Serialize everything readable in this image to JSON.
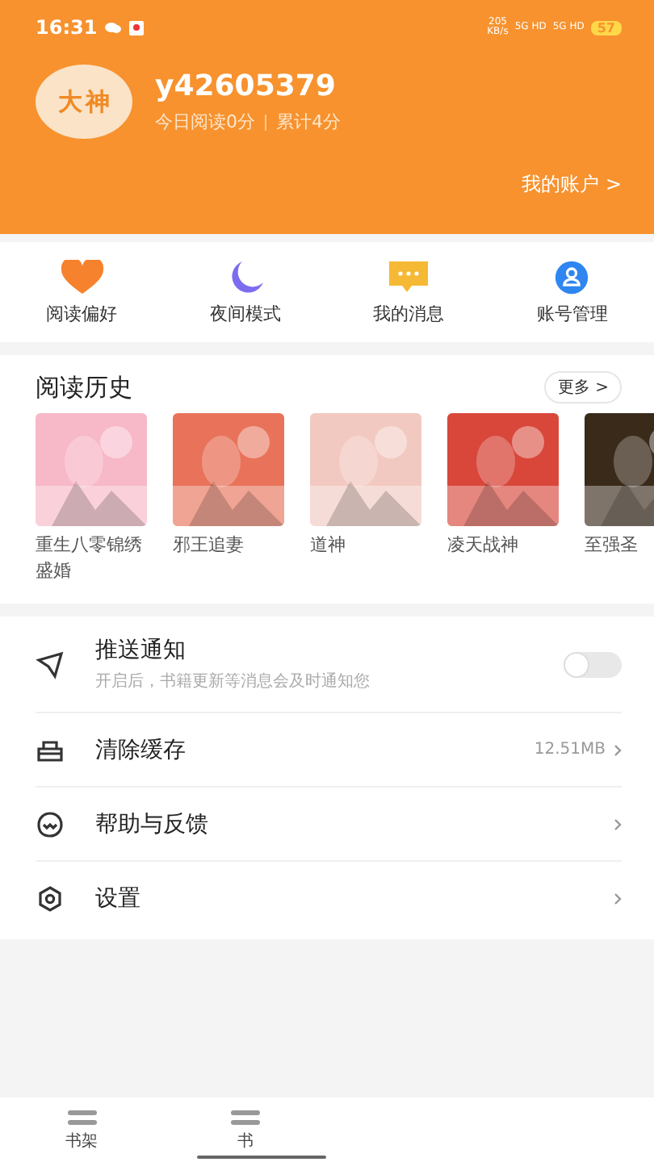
{
  "status_bar": {
    "time": "16:31",
    "network_speed": "205",
    "network_unit": "KB/s",
    "signal_1": "5G HD",
    "signal_2": "5G HD",
    "battery": "57"
  },
  "profile": {
    "avatar_text_1": "大",
    "avatar_text_2": "神",
    "username": "y42605379",
    "today_reading": "今日阅读0分",
    "total": "累计4分",
    "account_link": "我的账户 >"
  },
  "shortcuts": [
    {
      "label": "阅读偏好",
      "kind": "heart"
    },
    {
      "label": "夜间模式",
      "kind": "moon"
    },
    {
      "label": "我的消息",
      "kind": "message"
    },
    {
      "label": "账号管理",
      "kind": "user"
    }
  ],
  "history": {
    "title": "阅读历史",
    "more": "更多 >",
    "books": [
      {
        "title": "重生八零锦绣盛婚"
      },
      {
        "title": "邪王追妻"
      },
      {
        "title": "道神"
      },
      {
        "title": "凌天战神"
      },
      {
        "title": "至强圣"
      }
    ]
  },
  "settings": [
    {
      "label": "推送通知",
      "kind": "toggle",
      "hint": "开启后，书籍更新等消息会及时通知您",
      "on": false
    },
    {
      "label": "清除缓存",
      "kind": "link",
      "value": "12.51MB"
    },
    {
      "label": "帮助与反馈",
      "kind": "link"
    },
    {
      "label": "设置",
      "kind": "link"
    }
  ],
  "bottom_nav": [
    {
      "label": "书架",
      "selected": false
    },
    {
      "label": "书",
      "selected": false
    }
  ]
}
